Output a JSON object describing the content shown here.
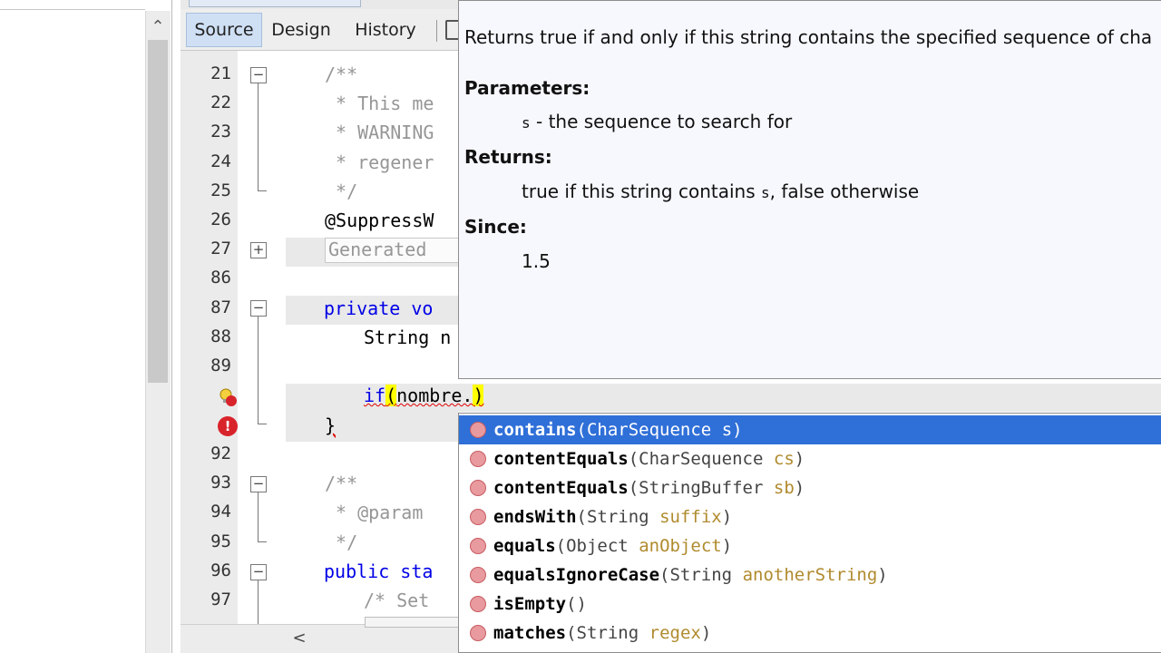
{
  "toolbar": {
    "tabs": [
      "Source",
      "Design",
      "History"
    ]
  },
  "gutter": {
    "line_numbers": [
      "21",
      "22",
      "23",
      "24",
      "25",
      "26",
      "27",
      "86",
      "87",
      "88",
      "89",
      "92",
      "93",
      "94",
      "95",
      "96",
      "97"
    ]
  },
  "code": {
    "lines": [
      "/**",
      " * This me",
      " * WARNING",
      " * regener",
      " */",
      "@SuppressW",
      "Generated",
      "private vo",
      "String n",
      "}",
      "/**",
      " * @param",
      " */",
      "public sta",
      "/* Set "
    ],
    "if_prefix": "if",
    "if_paren": "(",
    "if_middle": "nombre.",
    "if_close": ")"
  },
  "javadoc": {
    "description": "Returns true if and only if this string contains the specified sequence of cha",
    "parameters_heading": "Parameters:",
    "param_name": "s",
    "param_desc": " - the sequence to search for",
    "returns_heading": "Returns:",
    "returns_pre": "true if this string contains ",
    "returns_code": "s",
    "returns_post": ", false otherwise",
    "since_heading": "Since:",
    "since_value": "1.5"
  },
  "completion": {
    "items": [
      {
        "name": "contains",
        "open": "(",
        "type": "CharSequence",
        "param": "s",
        "close": ")"
      },
      {
        "name": "contentEquals",
        "open": "(",
        "type": "CharSequence",
        "param": "cs",
        "close": ")"
      },
      {
        "name": "contentEquals",
        "open": "(",
        "type": "StringBuffer",
        "param": "sb",
        "close": ")"
      },
      {
        "name": "endsWith",
        "open": "(",
        "type": "String",
        "param": "suffix",
        "close": ")"
      },
      {
        "name": "equals",
        "open": "(",
        "type": "Object",
        "param": "anObject",
        "close": ")"
      },
      {
        "name": "equalsIgnoreCase",
        "open": "(",
        "type": "String",
        "param": "anotherString",
        "close": ")"
      },
      {
        "name": "isEmpty",
        "open": "(",
        "type": "",
        "param": "",
        "close": ")"
      },
      {
        "name": "matches",
        "open": "(",
        "type": "String",
        "param": "regex",
        "close": ")"
      }
    ]
  },
  "icons": {
    "left_scroll_up": "chevron-up-icon",
    "hscroll_left": "chevron-left-icon",
    "hint": "lightbulb-error-icon",
    "error": "error-icon",
    "method": "method-icon"
  },
  "colors": {
    "selection": "#2f6fd8",
    "keyword": "#0000e6",
    "comment": "#969696",
    "error": "#d9232a"
  }
}
